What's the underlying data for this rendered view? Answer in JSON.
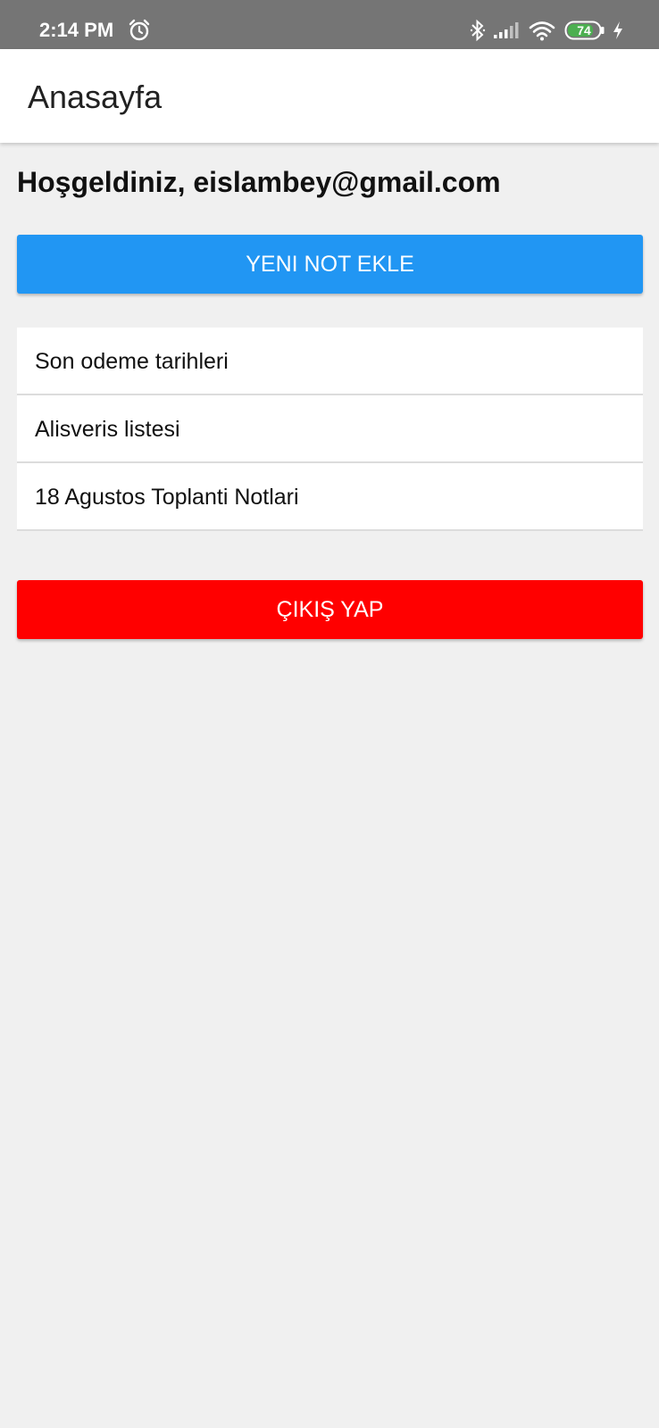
{
  "status_bar": {
    "time": "2:14 PM",
    "battery": "74",
    "icons": [
      "alarm-icon",
      "bluetooth-icon",
      "signal-icon",
      "wifi-icon",
      "battery-icon",
      "charging-icon"
    ]
  },
  "app_bar": {
    "title": "Anasayfa"
  },
  "main": {
    "welcome": "Hoşgeldiniz, eislambey@gmail.com",
    "add_note_label": "YENI NOT EKLE",
    "notes": [
      {
        "title": "Son odeme tarihleri"
      },
      {
        "title": "Alisveris listesi"
      },
      {
        "title": "18 Agustos Toplanti Notlari"
      }
    ],
    "logout_label": "ÇIKIŞ YAP"
  },
  "colors": {
    "status_bar": "#757575",
    "primary_button": "#2196f3",
    "logout_button": "#ff0000",
    "background": "#f0f0f0",
    "battery_fill": "#4caf50"
  }
}
